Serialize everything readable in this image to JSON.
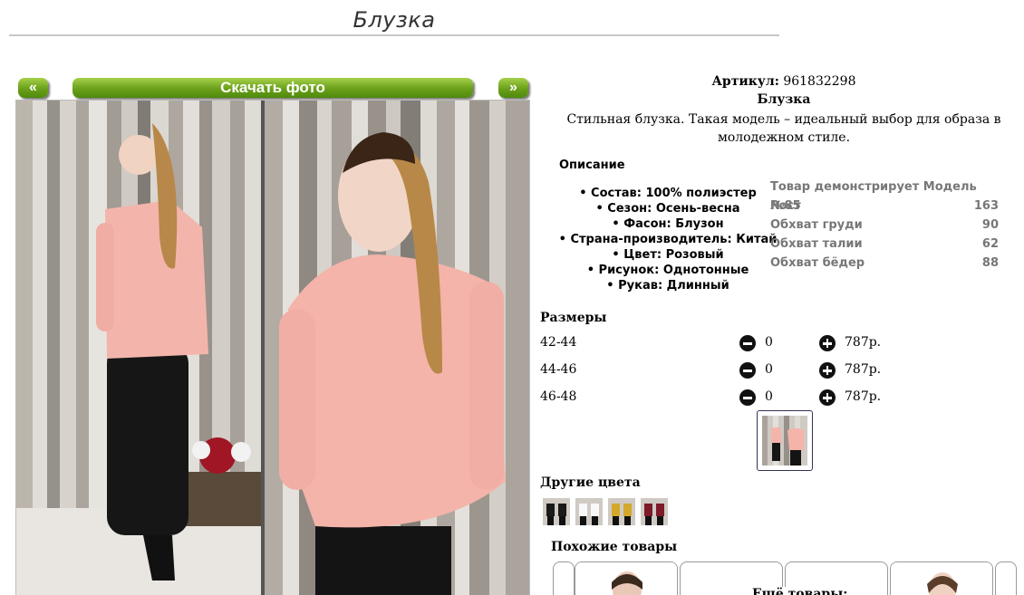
{
  "page": {
    "title": "Блузка"
  },
  "gallery": {
    "prev_label": "«",
    "next_label": "»",
    "download_label": "Скачать фото"
  },
  "product": {
    "article_label": "Артикул:",
    "article_value": "961832298",
    "name": "Блузка",
    "description": "Стильная блузка. Такая модель – идеальный выбор для образа в молодежном стиле."
  },
  "description_section": {
    "heading": "Описание",
    "features": [
      "Состав: 100% полиэстер",
      "Сезон: Осень-весна",
      "Фасон: Блузон",
      "Страна-производитель: Китай",
      "Цвет: Розовый",
      "Рисунок: Однотонные",
      "Рукав: Длинный"
    ]
  },
  "model": {
    "title": "Товар демонстрирует Модель №85",
    "rows": [
      {
        "label": "Рост",
        "value": "163"
      },
      {
        "label": "Обхват груди",
        "value": "90"
      },
      {
        "label": "Обхват талии",
        "value": "62"
      },
      {
        "label": "Обхват бёдер",
        "value": "88"
      }
    ]
  },
  "sizes": {
    "heading": "Размеры",
    "rows": [
      {
        "size": "42-44",
        "qty": "0",
        "price": "787р."
      },
      {
        "size": "44-46",
        "qty": "0",
        "price": "787р."
      },
      {
        "size": "46-48",
        "qty": "0",
        "price": "787р."
      }
    ]
  },
  "other_colors": {
    "heading": "Другие цвета"
  },
  "similar": {
    "heading": "Похожие товары",
    "more_heading": "Ещё товары:"
  },
  "colors": {
    "accent_green": "#6aa01a",
    "blouse_pink": "#f2b2a8",
    "dark": "#111111"
  }
}
